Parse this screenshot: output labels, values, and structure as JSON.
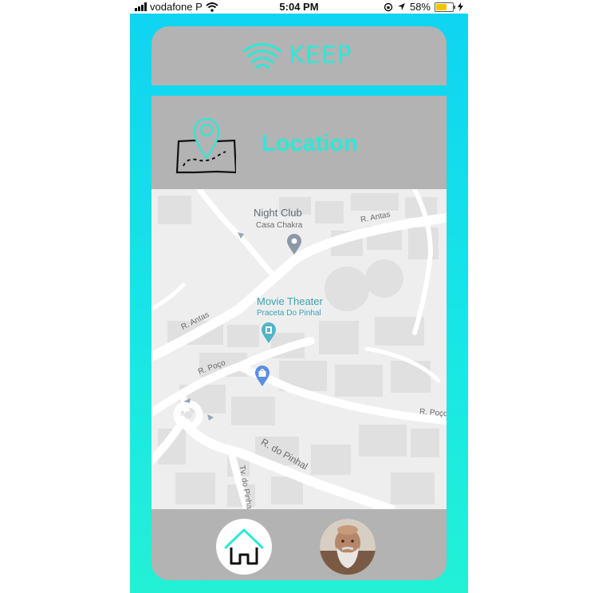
{
  "status_bar": {
    "carrier": "vodafone P",
    "time": "5:04 PM",
    "battery_percent": "58%",
    "battery_level": 0.58
  },
  "header": {
    "logo_text": "KEEP",
    "logo_icon": "wifi-signal-icon"
  },
  "location": {
    "title": "Location",
    "icon": "map-location-pin-icon"
  },
  "map": {
    "pois": [
      {
        "name": "Night Club",
        "subtitle": "Casa Chakra",
        "icon": "map-pin-icon"
      },
      {
        "name": "Movie Theater",
        "subtitle": "Praceta Do Pinhal",
        "icon": "movie-theater-pin-icon"
      },
      {
        "name": "",
        "subtitle": "",
        "icon": "shopping-pin-icon"
      }
    ],
    "streets": [
      "R. Antas",
      "R. Antas",
      "R. Poço",
      "R. Poço",
      "R. do Pinhal",
      "Tv. do Pinha"
    ]
  },
  "bottom_nav": {
    "home_icon": "home-icon",
    "profile_icon": "avatar"
  },
  "colors": {
    "accent": "#2ee8d7",
    "frame_top": "#0fd4f2",
    "frame_bottom": "#22f1d6",
    "card": "#b3b3b3",
    "map_bg": "#eeeeee",
    "pin_gray": "#8d98a7",
    "pin_teal": "#4fb6c6",
    "pin_blue": "#5b8ee0"
  }
}
